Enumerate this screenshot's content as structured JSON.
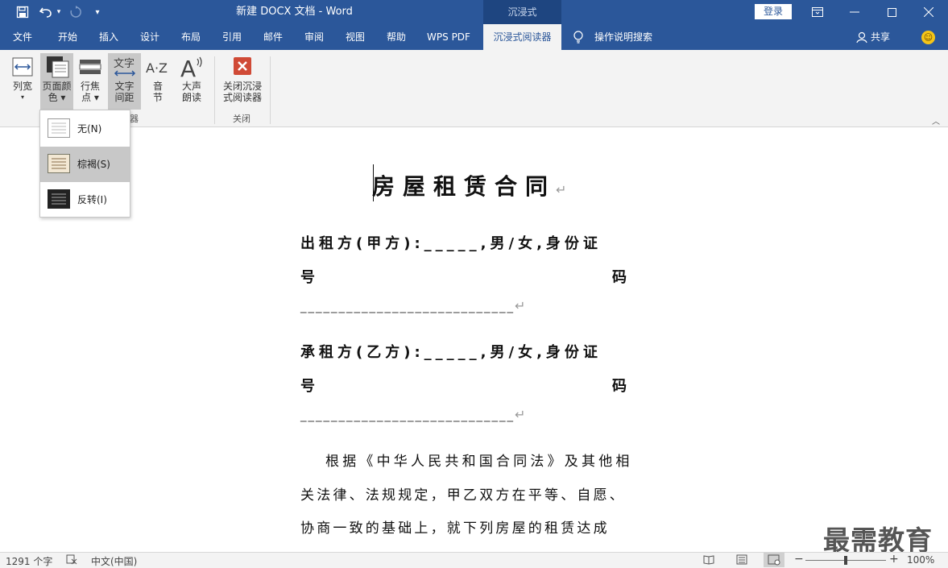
{
  "window": {
    "title": "新建 DOCX 文档  -  Word",
    "context_tab": "沉浸式",
    "login": "登录"
  },
  "menu": {
    "items": [
      "文件",
      "开始",
      "插入",
      "设计",
      "布局",
      "引用",
      "邮件",
      "审阅",
      "视图",
      "帮助",
      "WPS PDF",
      "沉浸式阅读器"
    ],
    "search": "操作说明搜索",
    "share": "共享"
  },
  "ribbon": {
    "column_width": [
      "列宽",
      "▾"
    ],
    "page_color": [
      "页面颜",
      "色 ▾"
    ],
    "line_focus": [
      "行焦",
      "点 ▾"
    ],
    "text_spacing": [
      "文字",
      "间距"
    ],
    "syllables": [
      "音",
      "节"
    ],
    "read_aloud": [
      "大声",
      "朗读"
    ],
    "close_reader": [
      "关闭沉浸",
      "式阅读器"
    ],
    "group_reader_partial": "器",
    "group_close": "关闭"
  },
  "page_color_menu": [
    {
      "label": "无(N)",
      "key": "N"
    },
    {
      "label": "棕褐(S)",
      "key": "S"
    },
    {
      "label": "反转(I)",
      "key": "I"
    }
  ],
  "document": {
    "title": "房屋租赁合同",
    "lines": [
      "出租方(甲方):_____,男/女,身份证",
      "号",
      "码",
      "____________________________",
      "承租方(乙方):_____,男/女,身份证",
      "号",
      "码",
      "____________________________"
    ],
    "body": [
      "根据《中华人民共和国合同法》及其他相",
      "关法律、法规规定，甲乙双方在平等、自愿、",
      "协商一致的基础上，就下列房屋的租赁达成"
    ],
    "para_mark": "↵"
  },
  "status": {
    "word_count": "1291 个字",
    "language": "中文(中国)",
    "zoom": "100%"
  },
  "watermark": "最需教育",
  "colors": {
    "accent": "#2b579a",
    "ribbon_bg": "#f3f3f3"
  }
}
